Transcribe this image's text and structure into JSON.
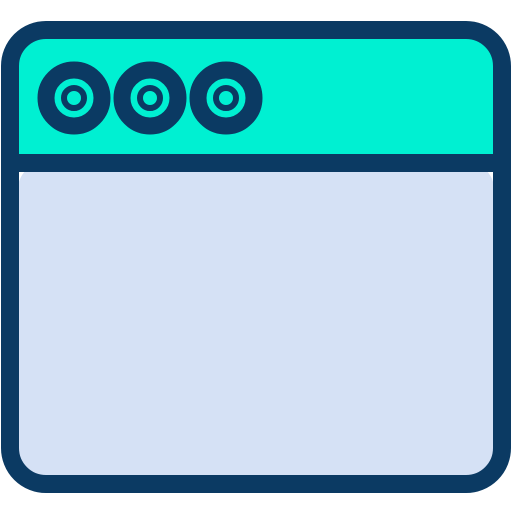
{
  "icon": {
    "name": "browser-window-icon",
    "colors": {
      "outline": "#0b3a63",
      "title_bar": "#00f0d2",
      "content": "#d5e1f5"
    },
    "window_controls": [
      "window-control-dot-1",
      "window-control-dot-2",
      "window-control-dot-3"
    ]
  }
}
